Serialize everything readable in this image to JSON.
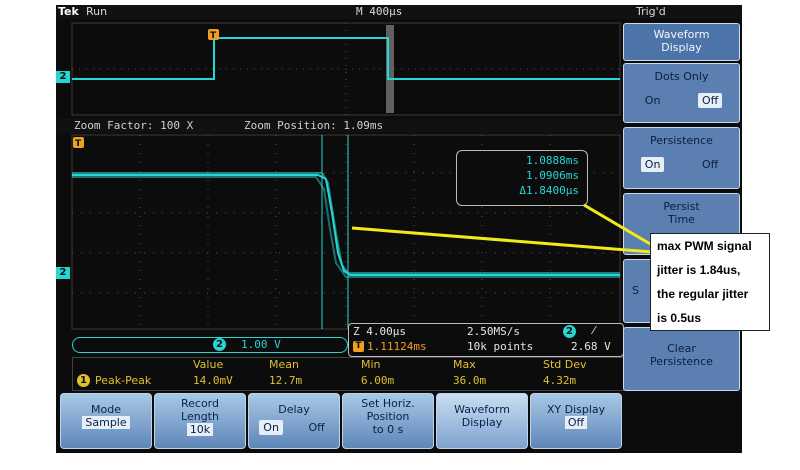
{
  "topbar": {
    "brand": "Tek",
    "run_state": "Run",
    "timebase": "M 400μs",
    "trigger_state": "Trig'd"
  },
  "zoom": {
    "factor_label": "Zoom Factor: 100 X",
    "position_label": "Zoom Position: 1.09ms"
  },
  "channel": {
    "number": "2",
    "scale": "1.00 V"
  },
  "cursor_box": {
    "t1": "1.0888ms",
    "t2": "1.0906ms",
    "delta": "Δ1.8400μs"
  },
  "zoom_info": {
    "timebase": "Z 4.00μs",
    "sample_rate": "2.50MS/s",
    "trigger_pos": "1.11124ms",
    "record": "10k points",
    "trigger_level": "2.68 V",
    "trigger_channel": "2",
    "slope_symbol": "⁄"
  },
  "measurements": {
    "headers": [
      "Value",
      "Mean",
      "Min",
      "Max",
      "Std Dev"
    ],
    "row_channel": "1",
    "row_label": "Peak-Peak",
    "values": [
      "14.0mV",
      "12.7m",
      "6.00m",
      "36.0m",
      "4.32m"
    ]
  },
  "side_menu": {
    "title_line1": "Waveform",
    "title_line2": "Display",
    "dots_only": "Dots Only",
    "dots_on": "On",
    "dots_off": "Off",
    "persistence": "Persistence",
    "persist_on": "On",
    "persist_off": "Off",
    "persist_time_line1": "Persist",
    "persist_time_line2": "Time",
    "clear_line1": "Clear",
    "clear_line2": "Persistence",
    "partial_letter": "S"
  },
  "bottom_menu": {
    "mode_label": "Mode",
    "mode_value": "Sample",
    "record_line1": "Record",
    "record_line2": "Length",
    "record_value": "10k",
    "delay_label": "Delay",
    "delay_on": "On",
    "delay_off": "Off",
    "sethoriz_line1": "Set Horiz.",
    "sethoriz_line2": "Position",
    "sethoriz_line3": "to 0 s",
    "waveform_line1": "Waveform",
    "waveform_line2": "Display",
    "xy_line1": "XY Display",
    "xy_value": "Off"
  },
  "annotation": {
    "line1": "max PWM signal",
    "line2": "jitter is 1.84us,",
    "line3": "the regular jitter",
    "line4": "is 0.5us"
  },
  "colors": {
    "trace": "#27d6d2",
    "marker": "#f0a020",
    "measurement": "#e0c030",
    "annotation_line": "#f2ea18",
    "menu": "#5a7fb0"
  }
}
